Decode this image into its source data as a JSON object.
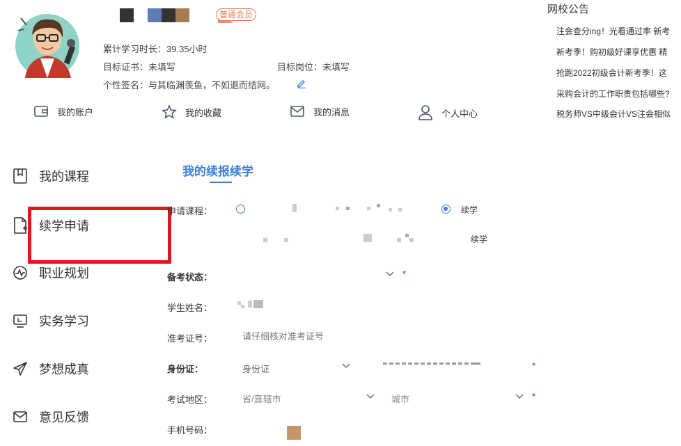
{
  "profile": {
    "member_badge": "普通会员",
    "study_time_label": "累计学习时长：",
    "study_time_value": "39.35小时",
    "target_cert_label": "目标证书：",
    "target_cert_value": "未填写",
    "target_post_label": "目标岗位：",
    "target_post_value": "未填写",
    "signature_label": "个性签名：",
    "signature_value": "与其临渊羡鱼，不如退而结网。"
  },
  "nav": [
    {
      "label": "我的账户",
      "icon": "wallet-icon"
    },
    {
      "label": "我的收藏",
      "icon": "star-icon"
    },
    {
      "label": "我的消息",
      "icon": "mail-icon"
    },
    {
      "label": "个人中心",
      "icon": "user-icon"
    }
  ],
  "announcements": {
    "title": "网校公告",
    "items": [
      "注会查分ing！光看通过率 新考",
      "新考季！购初级好课享优惠 精",
      "抢跑2022初级会计新考季！这",
      "采购会计的工作职责包括哪些?",
      "税务师VS中级会计VS注会相似"
    ]
  },
  "sidebar": [
    {
      "label": "我的课程",
      "icon": "bookmark-icon"
    },
    {
      "label": "续学申请",
      "icon": "file-add-icon"
    },
    {
      "label": "职业规划",
      "icon": "pulse-icon"
    },
    {
      "label": "实务学习",
      "icon": "monitor-icon"
    },
    {
      "label": "梦想成真",
      "icon": "send-icon"
    },
    {
      "label": "意见反馈",
      "icon": "envelope-icon"
    }
  ],
  "form": {
    "title": "我的续报续学",
    "course_label": "申请课程：",
    "option1_label": "续学",
    "option2_label": "续学",
    "exam_status_label": "备考状态：",
    "student_name_label": "学生姓名：",
    "ticket_label": "准考证号：",
    "ticket_placeholder": "请仔细核对准考证号",
    "id_label": "身份证：",
    "id_type_value": "身份证",
    "region_label": "考试地区：",
    "province_placeholder": "省/直辖市",
    "city_placeholder": "城市",
    "phone_label": "手机号码："
  },
  "colors": {
    "accent": "#3a7fd5",
    "highlight": "#e8141b",
    "required": "#d0021b"
  }
}
